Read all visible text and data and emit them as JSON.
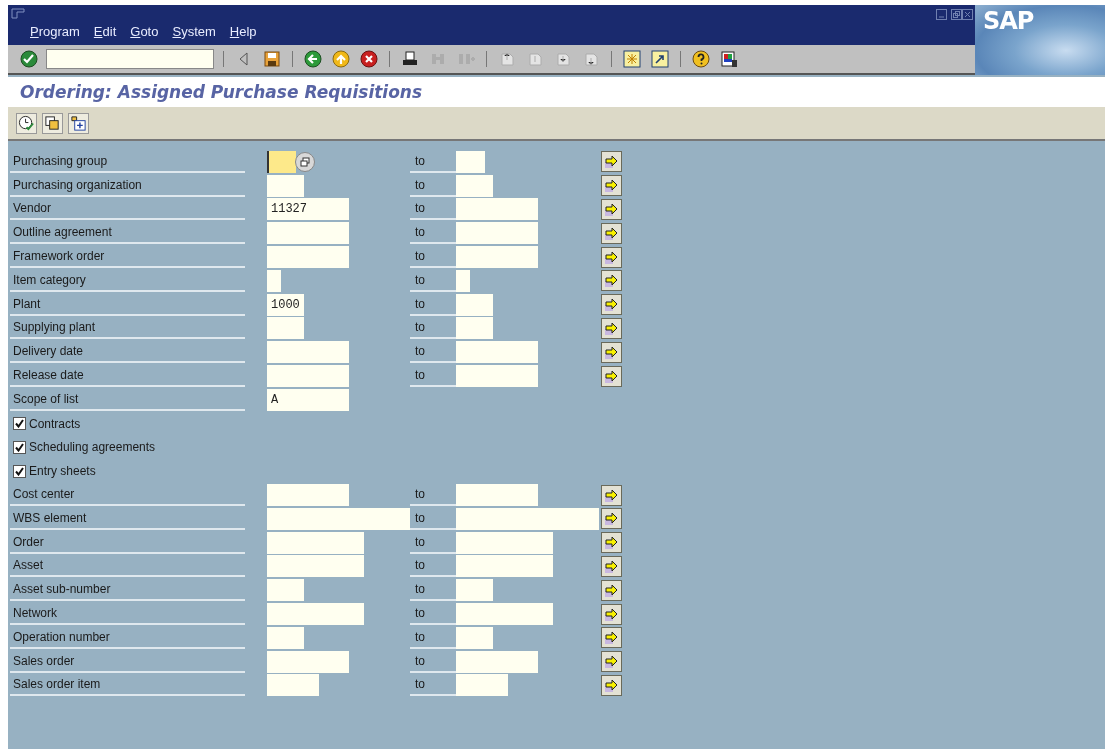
{
  "window": {
    "logo": "SAP"
  },
  "menu": [
    {
      "label": "Program"
    },
    {
      "label": "Edit"
    },
    {
      "label": "Goto"
    },
    {
      "label": "System"
    },
    {
      "label": "Help"
    }
  ],
  "toolbar": [
    {
      "kind": "enter",
      "disabled": false
    },
    {
      "kind": "command-field"
    },
    {
      "kind": "separator"
    },
    {
      "kind": "collapse",
      "disabled": false
    },
    {
      "kind": "save",
      "disabled": false
    },
    {
      "kind": "separator"
    },
    {
      "kind": "back",
      "disabled": false
    },
    {
      "kind": "exit",
      "disabled": false
    },
    {
      "kind": "cancel",
      "disabled": false
    },
    {
      "kind": "separator"
    },
    {
      "kind": "print",
      "disabled": false
    },
    {
      "kind": "find",
      "disabled": true
    },
    {
      "kind": "find-next",
      "disabled": true
    },
    {
      "kind": "separator"
    },
    {
      "kind": "first-page",
      "disabled": true
    },
    {
      "kind": "prev-page",
      "disabled": true
    },
    {
      "kind": "next-page",
      "disabled": true
    },
    {
      "kind": "last-page",
      "disabled": true
    },
    {
      "kind": "separator"
    },
    {
      "kind": "new-session",
      "disabled": false
    },
    {
      "kind": "shortcut",
      "disabled": false
    },
    {
      "kind": "separator"
    },
    {
      "kind": "help",
      "disabled": false
    },
    {
      "kind": "layout",
      "disabled": false
    }
  ],
  "title": "Ordering: Assigned Purchase Requisitions",
  "app_toolbar": [
    {
      "kind": "execute"
    },
    {
      "kind": "variant"
    },
    {
      "kind": "dynamic-selection"
    }
  ],
  "rows": [
    {
      "kind": "range",
      "label": "Purchasing group",
      "low": "",
      "focused": true,
      "to": "to",
      "high": ""
    },
    {
      "kind": "range",
      "label": "Purchasing organization",
      "low": "",
      "focused": false,
      "to": "to",
      "high": ""
    },
    {
      "kind": "range",
      "label": "Vendor",
      "low": "11327",
      "focused": false,
      "to": "to",
      "high": ""
    },
    {
      "kind": "range",
      "label": "Outline agreement",
      "low": "",
      "focused": false,
      "to": "to",
      "high": ""
    },
    {
      "kind": "range",
      "label": "Framework order",
      "low": "",
      "focused": false,
      "to": "to",
      "high": ""
    },
    {
      "kind": "range",
      "label": "Item category",
      "low": "",
      "focused": false,
      "to": "to",
      "high": ""
    },
    {
      "kind": "range",
      "label": "Plant",
      "low": "1000",
      "focused": false,
      "to": "to",
      "high": ""
    },
    {
      "kind": "range",
      "label": "Supplying plant",
      "low": "",
      "focused": false,
      "to": "to",
      "high": ""
    },
    {
      "kind": "range",
      "label": "Delivery date",
      "low": "",
      "focused": false,
      "to": "to",
      "high": ""
    },
    {
      "kind": "range",
      "label": "Release date",
      "low": "",
      "focused": false,
      "to": "to",
      "high": ""
    },
    {
      "kind": "single",
      "label": "Scope of list",
      "low": "A",
      "focused": false
    },
    {
      "kind": "checkbox",
      "label": "Contracts",
      "checked": true
    },
    {
      "kind": "checkbox",
      "label": "Scheduling agreements",
      "checked": true
    },
    {
      "kind": "checkbox",
      "label": "Entry sheets",
      "checked": true
    },
    {
      "kind": "range",
      "label": "Cost center",
      "low": "",
      "focused": false,
      "to": "to",
      "high": ""
    },
    {
      "kind": "range",
      "label": "WBS element",
      "low": "",
      "focused": false,
      "to": "to",
      "high": ""
    },
    {
      "kind": "range",
      "label": "Order",
      "low": "",
      "focused": false,
      "to": "to",
      "high": ""
    },
    {
      "kind": "range",
      "label": "Asset",
      "low": "",
      "focused": false,
      "to": "to",
      "high": ""
    },
    {
      "kind": "range",
      "label": "Asset sub-number",
      "low": "",
      "focused": false,
      "to": "to",
      "high": ""
    },
    {
      "kind": "range",
      "label": "Network",
      "low": "",
      "focused": false,
      "to": "to",
      "high": ""
    },
    {
      "kind": "range",
      "label": "Operation number",
      "low": "",
      "focused": false,
      "to": "to",
      "high": ""
    },
    {
      "kind": "range",
      "label": "Sales order",
      "low": "",
      "focused": false,
      "to": "to",
      "high": ""
    },
    {
      "kind": "range",
      "label": "Sales order item",
      "low": "",
      "focused": false,
      "to": "to",
      "high": ""
    }
  ]
}
